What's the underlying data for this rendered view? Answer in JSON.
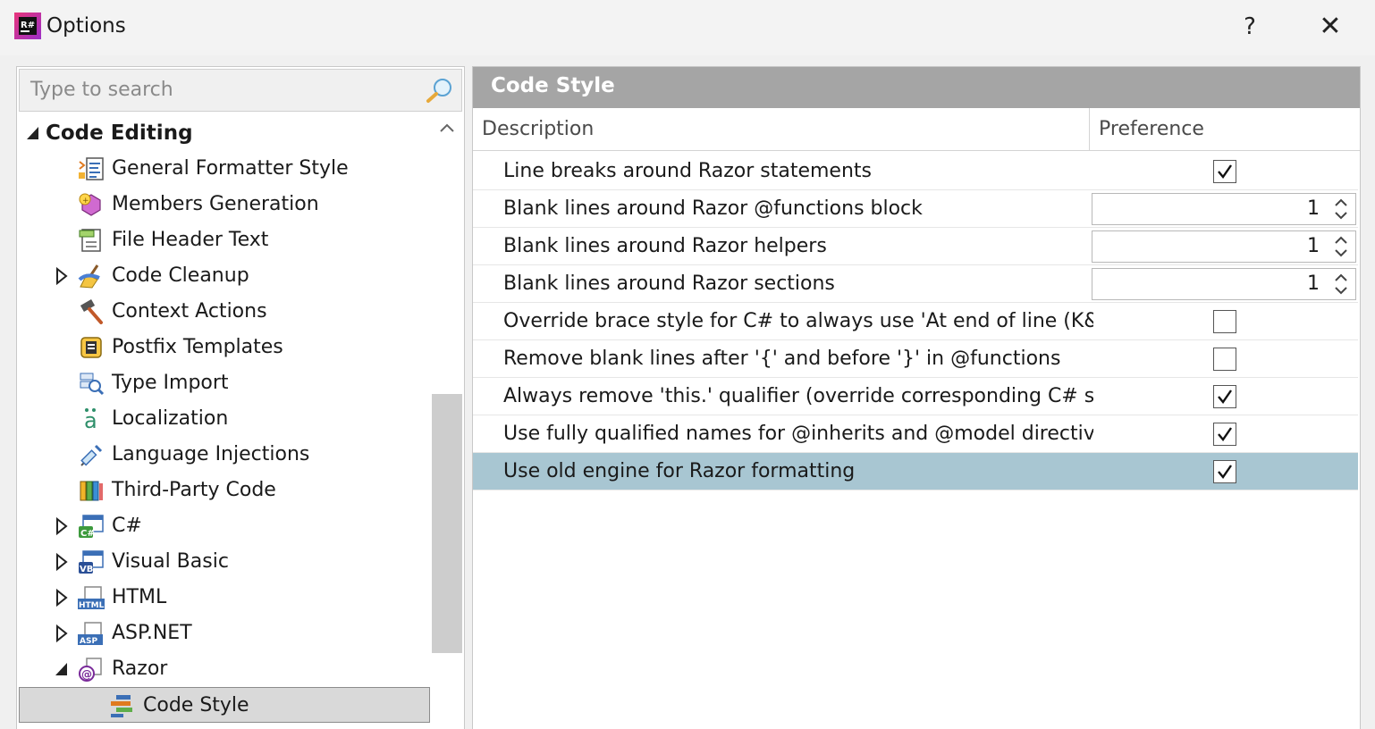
{
  "window": {
    "title": "Options",
    "help_label": "?",
    "close_label": "✕"
  },
  "search": {
    "placeholder": "Type to search"
  },
  "tree": {
    "items": [
      {
        "label": "Code Editing",
        "icon": "none",
        "expander": "expanded",
        "bold": true
      },
      {
        "label": "General Formatter Style",
        "icon": "formatter-icon",
        "expander": "none"
      },
      {
        "label": "Members Generation",
        "icon": "members-generation-icon",
        "expander": "none"
      },
      {
        "label": "File Header Text",
        "icon": "file-header-icon",
        "expander": "none"
      },
      {
        "label": "Code Cleanup",
        "icon": "broom-icon",
        "expander": "collapsed"
      },
      {
        "label": "Context Actions",
        "icon": "hammer-icon",
        "expander": "none"
      },
      {
        "label": "Postfix Templates",
        "icon": "postfix-templates-icon",
        "expander": "none"
      },
      {
        "label": "Type Import",
        "icon": "type-import-icon",
        "expander": "none"
      },
      {
        "label": "Localization",
        "icon": "localization-icon",
        "expander": "none"
      },
      {
        "label": "Language Injections",
        "icon": "syringe-icon",
        "expander": "none"
      },
      {
        "label": "Third-Party Code",
        "icon": "library-books-icon",
        "expander": "none"
      },
      {
        "label": "C#",
        "icon": "csharp-icon",
        "expander": "collapsed"
      },
      {
        "label": "Visual Basic",
        "icon": "vb-icon",
        "expander": "collapsed"
      },
      {
        "label": "HTML",
        "icon": "html-icon",
        "expander": "collapsed"
      },
      {
        "label": "ASP.NET",
        "icon": "aspnet-icon",
        "expander": "collapsed"
      },
      {
        "label": "Razor",
        "icon": "razor-icon",
        "expander": "expanded"
      },
      {
        "label": "Code Style",
        "icon": "code-style-icon",
        "expander": "none",
        "selected": true
      }
    ]
  },
  "page": {
    "title": "Code Style",
    "columns": {
      "description": "Description",
      "preference": "Preference"
    },
    "rows": [
      {
        "description": "Line breaks around Razor statements",
        "type": "checkbox",
        "checked": true
      },
      {
        "description": "Blank lines around Razor @functions block",
        "type": "number",
        "value": "1"
      },
      {
        "description": "Blank lines around Razor helpers",
        "type": "number",
        "value": "1"
      },
      {
        "description": "Blank lines around Razor sections",
        "type": "number",
        "value": "1"
      },
      {
        "description": "Override brace style for C# to always use 'At end of line (K&…",
        "type": "checkbox",
        "checked": false
      },
      {
        "description": "Remove blank lines after '{' and before '}' in @functions",
        "type": "checkbox",
        "checked": false
      },
      {
        "description": "Always remove 'this.' qualifier (override corresponding C# se…",
        "type": "checkbox",
        "checked": true
      },
      {
        "description": "Use fully qualified names for @inherits and @model directives",
        "type": "checkbox",
        "checked": true
      },
      {
        "description": "Use old engine for Razor formatting",
        "type": "checkbox",
        "checked": true,
        "selected": true
      }
    ]
  },
  "colors": {
    "header": "#a5a5a5",
    "selected_row": "#a8c6d2",
    "tree_selected": "#d9d9d9"
  }
}
